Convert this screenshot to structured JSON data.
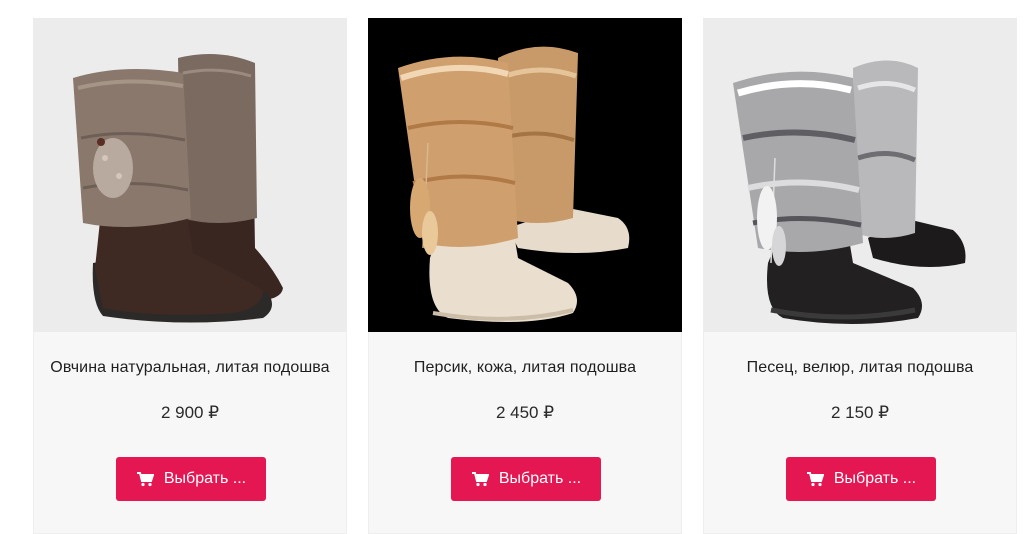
{
  "products": [
    {
      "name": "Овчина натуральная, литая подошва",
      "price": "2 900 ₽",
      "button_label": "Выбрать ...",
      "photo_bg": "#ececec"
    },
    {
      "name": "Персик, кожа, литая подошва",
      "price": "2 450 ₽",
      "button_label": "Выбрать ...",
      "photo_bg": "#000000"
    },
    {
      "name": "Песец, велюр, литая подошва",
      "price": "2 150 ₽",
      "button_label": "Выбрать ...",
      "photo_bg": "#ececec"
    }
  ],
  "colors": {
    "button": "#e41753",
    "card_bg": "#f7f7f8"
  },
  "icons": {
    "button_icon": "cart-icon"
  }
}
